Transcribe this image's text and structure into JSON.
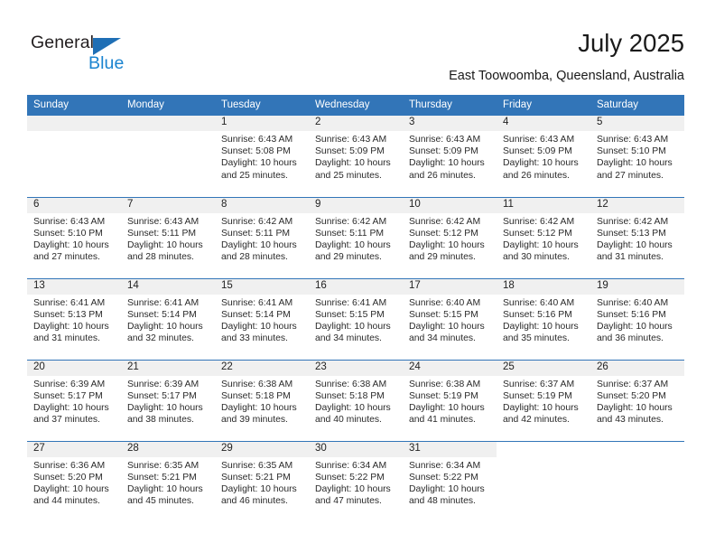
{
  "brand": {
    "name_top": "General",
    "name_bottom": "Blue",
    "triangle_icon": "triangle-icon",
    "color_dark": "#231f20",
    "color_blue": "#1b84d0"
  },
  "header": {
    "title": "July 2025",
    "subtitle": "East Toowoomba, Queensland, Australia"
  },
  "theme": {
    "header_bg": "#3275b8",
    "header_text": "#ffffff",
    "daynum_bg": "#f0f0f0",
    "row_divider": "#3275b8",
    "body_text": "#2a2a2a"
  },
  "calendar": {
    "weekday_headers": [
      "Sunday",
      "Monday",
      "Tuesday",
      "Wednesday",
      "Thursday",
      "Friday",
      "Saturday"
    ],
    "labels": {
      "sunrise": "Sunrise:",
      "sunset": "Sunset:",
      "daylight": "Daylight:"
    },
    "weeks": [
      [
        {
          "day": "",
          "lines": []
        },
        {
          "day": "",
          "lines": []
        },
        {
          "day": "1",
          "lines": [
            "Sunrise: 6:43 AM",
            "Sunset: 5:08 PM",
            "Daylight: 10 hours",
            "and 25 minutes."
          ]
        },
        {
          "day": "2",
          "lines": [
            "Sunrise: 6:43 AM",
            "Sunset: 5:09 PM",
            "Daylight: 10 hours",
            "and 25 minutes."
          ]
        },
        {
          "day": "3",
          "lines": [
            "Sunrise: 6:43 AM",
            "Sunset: 5:09 PM",
            "Daylight: 10 hours",
            "and 26 minutes."
          ]
        },
        {
          "day": "4",
          "lines": [
            "Sunrise: 6:43 AM",
            "Sunset: 5:09 PM",
            "Daylight: 10 hours",
            "and 26 minutes."
          ]
        },
        {
          "day": "5",
          "lines": [
            "Sunrise: 6:43 AM",
            "Sunset: 5:10 PM",
            "Daylight: 10 hours",
            "and 27 minutes."
          ]
        }
      ],
      [
        {
          "day": "6",
          "lines": [
            "Sunrise: 6:43 AM",
            "Sunset: 5:10 PM",
            "Daylight: 10 hours",
            "and 27 minutes."
          ]
        },
        {
          "day": "7",
          "lines": [
            "Sunrise: 6:43 AM",
            "Sunset: 5:11 PM",
            "Daylight: 10 hours",
            "and 28 minutes."
          ]
        },
        {
          "day": "8",
          "lines": [
            "Sunrise: 6:42 AM",
            "Sunset: 5:11 PM",
            "Daylight: 10 hours",
            "and 28 minutes."
          ]
        },
        {
          "day": "9",
          "lines": [
            "Sunrise: 6:42 AM",
            "Sunset: 5:11 PM",
            "Daylight: 10 hours",
            "and 29 minutes."
          ]
        },
        {
          "day": "10",
          "lines": [
            "Sunrise: 6:42 AM",
            "Sunset: 5:12 PM",
            "Daylight: 10 hours",
            "and 29 minutes."
          ]
        },
        {
          "day": "11",
          "lines": [
            "Sunrise: 6:42 AM",
            "Sunset: 5:12 PM",
            "Daylight: 10 hours",
            "and 30 minutes."
          ]
        },
        {
          "day": "12",
          "lines": [
            "Sunrise: 6:42 AM",
            "Sunset: 5:13 PM",
            "Daylight: 10 hours",
            "and 31 minutes."
          ]
        }
      ],
      [
        {
          "day": "13",
          "lines": [
            "Sunrise: 6:41 AM",
            "Sunset: 5:13 PM",
            "Daylight: 10 hours",
            "and 31 minutes."
          ]
        },
        {
          "day": "14",
          "lines": [
            "Sunrise: 6:41 AM",
            "Sunset: 5:14 PM",
            "Daylight: 10 hours",
            "and 32 minutes."
          ]
        },
        {
          "day": "15",
          "lines": [
            "Sunrise: 6:41 AM",
            "Sunset: 5:14 PM",
            "Daylight: 10 hours",
            "and 33 minutes."
          ]
        },
        {
          "day": "16",
          "lines": [
            "Sunrise: 6:41 AM",
            "Sunset: 5:15 PM",
            "Daylight: 10 hours",
            "and 34 minutes."
          ]
        },
        {
          "day": "17",
          "lines": [
            "Sunrise: 6:40 AM",
            "Sunset: 5:15 PM",
            "Daylight: 10 hours",
            "and 34 minutes."
          ]
        },
        {
          "day": "18",
          "lines": [
            "Sunrise: 6:40 AM",
            "Sunset: 5:16 PM",
            "Daylight: 10 hours",
            "and 35 minutes."
          ]
        },
        {
          "day": "19",
          "lines": [
            "Sunrise: 6:40 AM",
            "Sunset: 5:16 PM",
            "Daylight: 10 hours",
            "and 36 minutes."
          ]
        }
      ],
      [
        {
          "day": "20",
          "lines": [
            "Sunrise: 6:39 AM",
            "Sunset: 5:17 PM",
            "Daylight: 10 hours",
            "and 37 minutes."
          ]
        },
        {
          "day": "21",
          "lines": [
            "Sunrise: 6:39 AM",
            "Sunset: 5:17 PM",
            "Daylight: 10 hours",
            "and 38 minutes."
          ]
        },
        {
          "day": "22",
          "lines": [
            "Sunrise: 6:38 AM",
            "Sunset: 5:18 PM",
            "Daylight: 10 hours",
            "and 39 minutes."
          ]
        },
        {
          "day": "23",
          "lines": [
            "Sunrise: 6:38 AM",
            "Sunset: 5:18 PM",
            "Daylight: 10 hours",
            "and 40 minutes."
          ]
        },
        {
          "day": "24",
          "lines": [
            "Sunrise: 6:38 AM",
            "Sunset: 5:19 PM",
            "Daylight: 10 hours",
            "and 41 minutes."
          ]
        },
        {
          "day": "25",
          "lines": [
            "Sunrise: 6:37 AM",
            "Sunset: 5:19 PM",
            "Daylight: 10 hours",
            "and 42 minutes."
          ]
        },
        {
          "day": "26",
          "lines": [
            "Sunrise: 6:37 AM",
            "Sunset: 5:20 PM",
            "Daylight: 10 hours",
            "and 43 minutes."
          ]
        }
      ],
      [
        {
          "day": "27",
          "lines": [
            "Sunrise: 6:36 AM",
            "Sunset: 5:20 PM",
            "Daylight: 10 hours",
            "and 44 minutes."
          ]
        },
        {
          "day": "28",
          "lines": [
            "Sunrise: 6:35 AM",
            "Sunset: 5:21 PM",
            "Daylight: 10 hours",
            "and 45 minutes."
          ]
        },
        {
          "day": "29",
          "lines": [
            "Sunrise: 6:35 AM",
            "Sunset: 5:21 PM",
            "Daylight: 10 hours",
            "and 46 minutes."
          ]
        },
        {
          "day": "30",
          "lines": [
            "Sunrise: 6:34 AM",
            "Sunset: 5:22 PM",
            "Daylight: 10 hours",
            "and 47 minutes."
          ]
        },
        {
          "day": "31",
          "lines": [
            "Sunrise: 6:34 AM",
            "Sunset: 5:22 PM",
            "Daylight: 10 hours",
            "and 48 minutes."
          ]
        },
        {
          "day": "",
          "lines": [],
          "blank": true
        },
        {
          "day": "",
          "lines": [],
          "blank": true
        }
      ]
    ]
  }
}
